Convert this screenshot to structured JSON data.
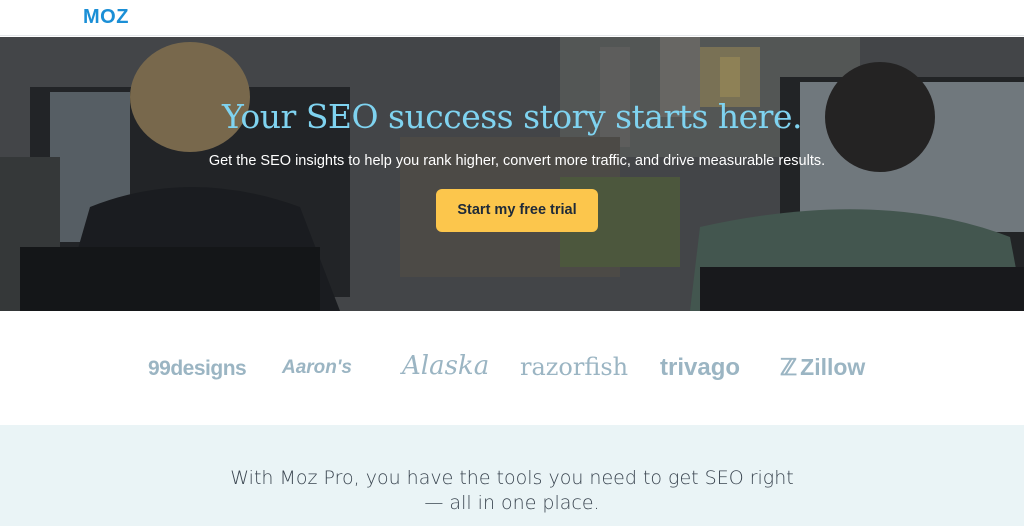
{
  "header": {
    "logo_text": "MOZ",
    "brand_color": "#1b8fd6"
  },
  "hero": {
    "headline": "Your SEO success story starts here.",
    "subheadline": "Get the SEO insights to help you rank higher, convert more traffic, and drive measurable results.",
    "cta_label": "Start my free trial",
    "headline_color": "#7fd3f0",
    "cta_color": "#fcc64c"
  },
  "customers": {
    "logos": [
      "99designs",
      "Aaron's",
      "Alaska",
      "razorfish",
      "trivago",
      "Zillow"
    ],
    "logo_color": "#9bb5c3"
  },
  "intro": {
    "text": "With Moz Pro, you have the tools you need to get SEO right — all in one place."
  }
}
